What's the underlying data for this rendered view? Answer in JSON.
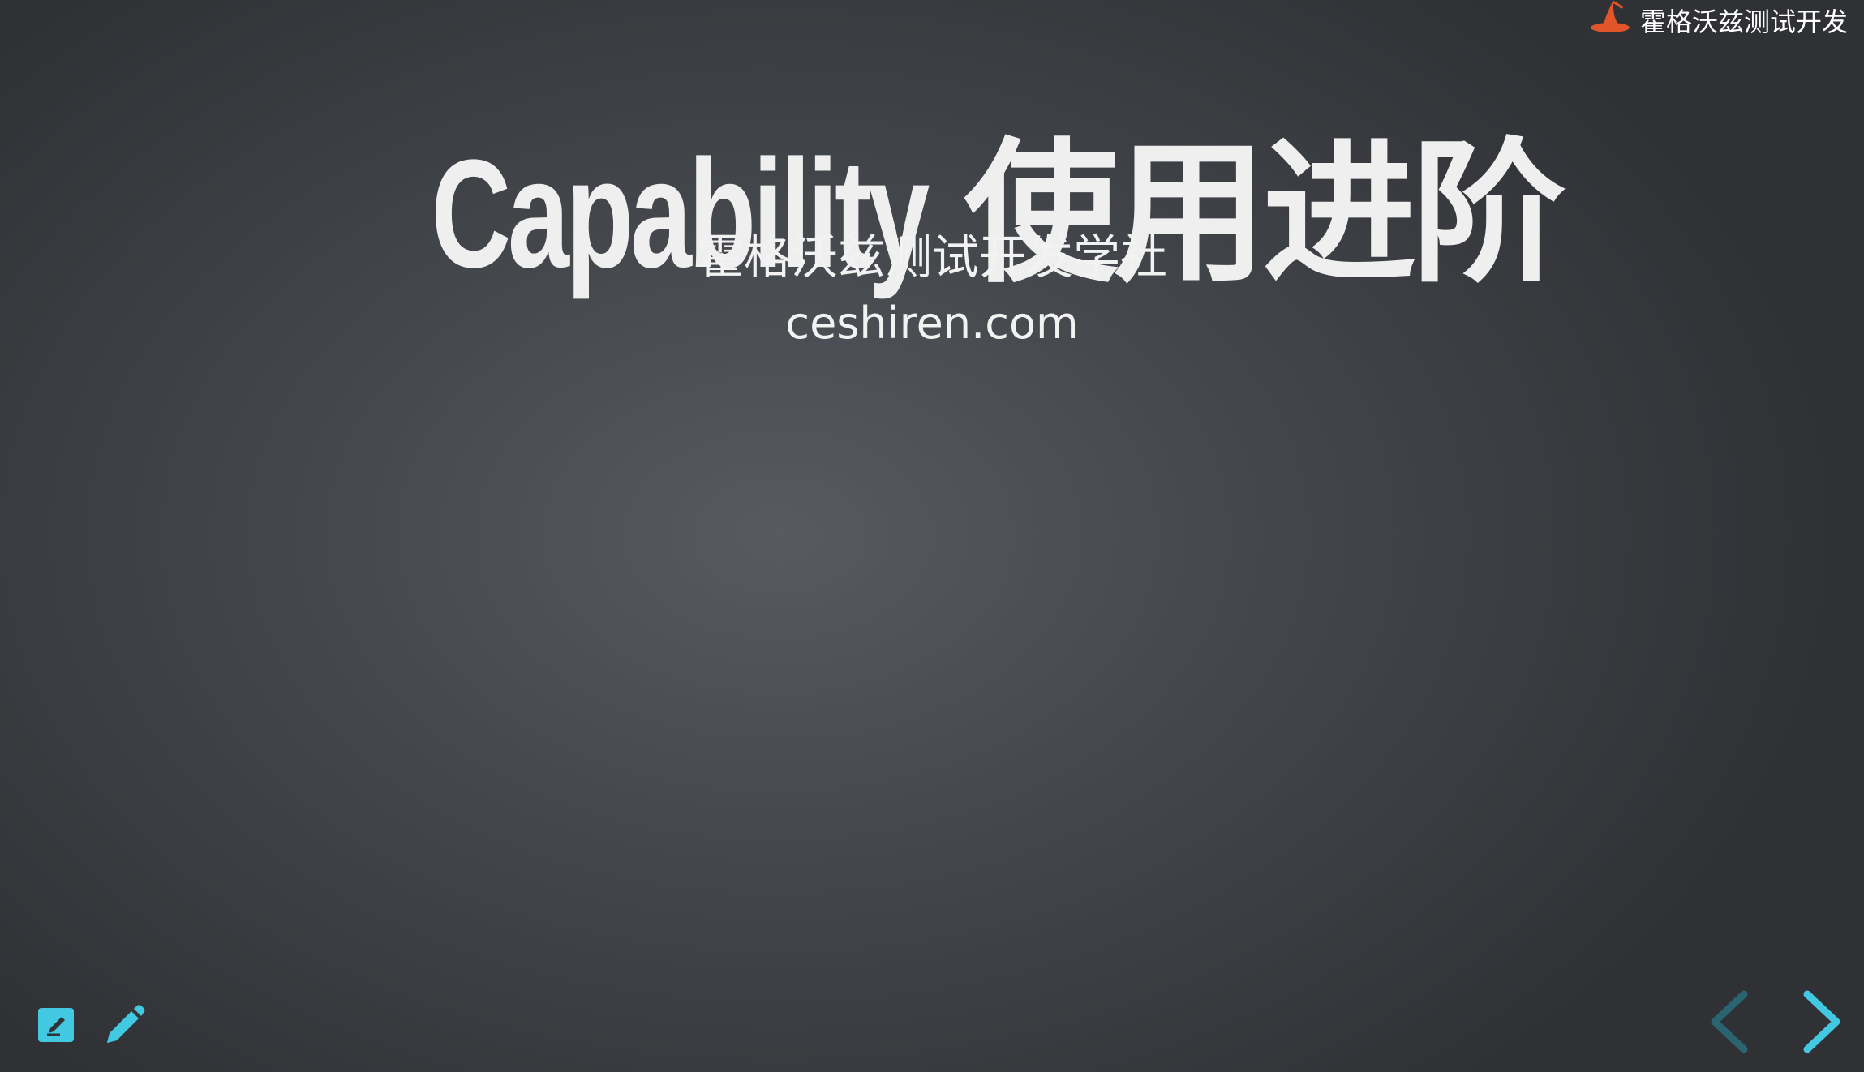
{
  "slide": {
    "title_en": "Capability",
    "title_zh": "使用进阶",
    "subtitle": "霍格沃兹测试开发学社",
    "url": "ceshiren.com"
  },
  "brand": {
    "text": "霍格沃兹测试开发",
    "logo_icon": "wizard-hat-icon",
    "logo_color": "#e0562a"
  },
  "toolbar": {
    "notes_icon": "edit-note-icon",
    "pen_icon": "pencil-icon",
    "accent": "#42c8e0"
  },
  "navigation": {
    "prev_icon": "chevron-left-icon",
    "next_icon": "chevron-right-icon",
    "prev_color": "#2a6470",
    "next_color": "#42c8e0"
  }
}
